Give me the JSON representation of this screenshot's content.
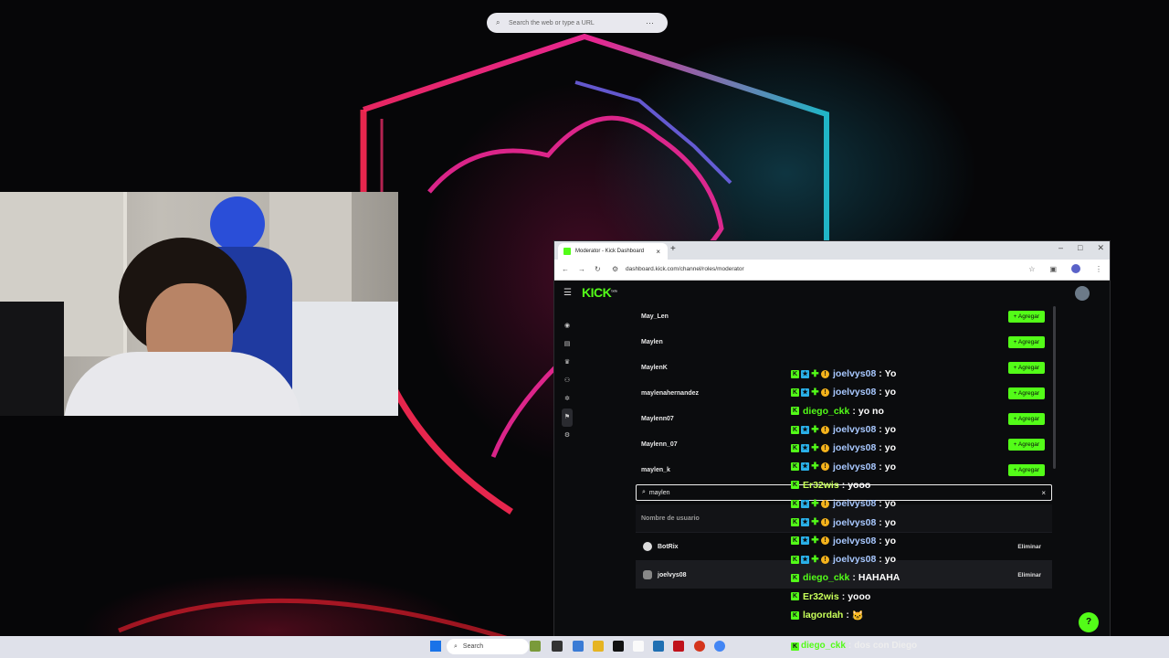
{
  "desktop": {
    "search_placeholder": "Search the web or type a URL"
  },
  "browser": {
    "tab_title": "Moderator - Kick Dashboard",
    "new_tab": "+",
    "url": "dashboard.kick.com/channel/roles/moderator",
    "logo": "KICK",
    "logo_sup": "beta"
  },
  "dashboard": {
    "results": [
      {
        "name": "May_Len",
        "action": "Agregar"
      },
      {
        "name": "Maylen",
        "action": "Agregar"
      },
      {
        "name": "MaylenK",
        "action": "Agregar"
      },
      {
        "name": "maylenahernandez",
        "action": "Agregar"
      },
      {
        "name": "Maylenn07",
        "action": "Agregar"
      },
      {
        "name": "Maylenn_07",
        "action": "Agregar"
      },
      {
        "name": "maylen_k",
        "action": "Agregar"
      }
    ],
    "add_prefix": "+",
    "search_value": "maylen",
    "table_header": "Nombre de usuario",
    "moderators": [
      {
        "name": "BotRix",
        "action": "Eliminar"
      },
      {
        "name": "joelvys08",
        "action": "Eliminar"
      }
    ]
  },
  "chat": [
    {
      "user": "joelvys08",
      "color": "#a8c8ff",
      "badges": [
        "kick",
        "star",
        "sub",
        "coin"
      ],
      "text": "Yo"
    },
    {
      "user": "joelvys08",
      "color": "#a8c8ff",
      "badges": [
        "kick",
        "star",
        "sub",
        "coin"
      ],
      "text": "yo"
    },
    {
      "user": "diego_ckk",
      "color": "#53fc18",
      "badges": [
        "kick"
      ],
      "text": "yo no"
    },
    {
      "user": "joelvys08",
      "color": "#a8c8ff",
      "badges": [
        "kick",
        "star",
        "sub",
        "coin"
      ],
      "text": "yo"
    },
    {
      "user": "joelvys08",
      "color": "#a8c8ff",
      "badges": [
        "kick",
        "star",
        "sub",
        "coin"
      ],
      "text": "yo"
    },
    {
      "user": "joelvys08",
      "color": "#a8c8ff",
      "badges": [
        "kick",
        "star",
        "sub",
        "coin"
      ],
      "text": "yo"
    },
    {
      "user": "Er32wis",
      "color": "#c8ff5a",
      "badges": [
        "kick"
      ],
      "text": "yooo"
    },
    {
      "user": "joelvys08",
      "color": "#a8c8ff",
      "badges": [
        "kick",
        "star",
        "sub",
        "coin"
      ],
      "text": "yo"
    },
    {
      "user": "joelvys08",
      "color": "#a8c8ff",
      "badges": [
        "kick",
        "star",
        "sub",
        "coin"
      ],
      "text": "yo"
    },
    {
      "user": "joelvys08",
      "color": "#a8c8ff",
      "badges": [
        "kick",
        "star",
        "sub",
        "coin"
      ],
      "text": "yo"
    },
    {
      "user": "joelvys08",
      "color": "#a8c8ff",
      "badges": [
        "kick",
        "star",
        "sub",
        "coin"
      ],
      "text": "yo"
    },
    {
      "user": "diego_ckk",
      "color": "#53fc18",
      "badges": [
        "kick"
      ],
      "text": "HAHAHA"
    },
    {
      "user": "Er32wis",
      "color": "#c8ff5a",
      "badges": [
        "kick"
      ],
      "text": "yooo"
    },
    {
      "user": "lagordah",
      "color": "#c8ff5a",
      "badges": [
        "kick"
      ],
      "text": "🐱"
    }
  ],
  "taskbar": {
    "search_label": "Search",
    "chat_user": "diego_ckk",
    "chat_text": "dos con Diego"
  },
  "colors": {
    "kick_green": "#53fc18",
    "background": "#0b0c0e"
  }
}
